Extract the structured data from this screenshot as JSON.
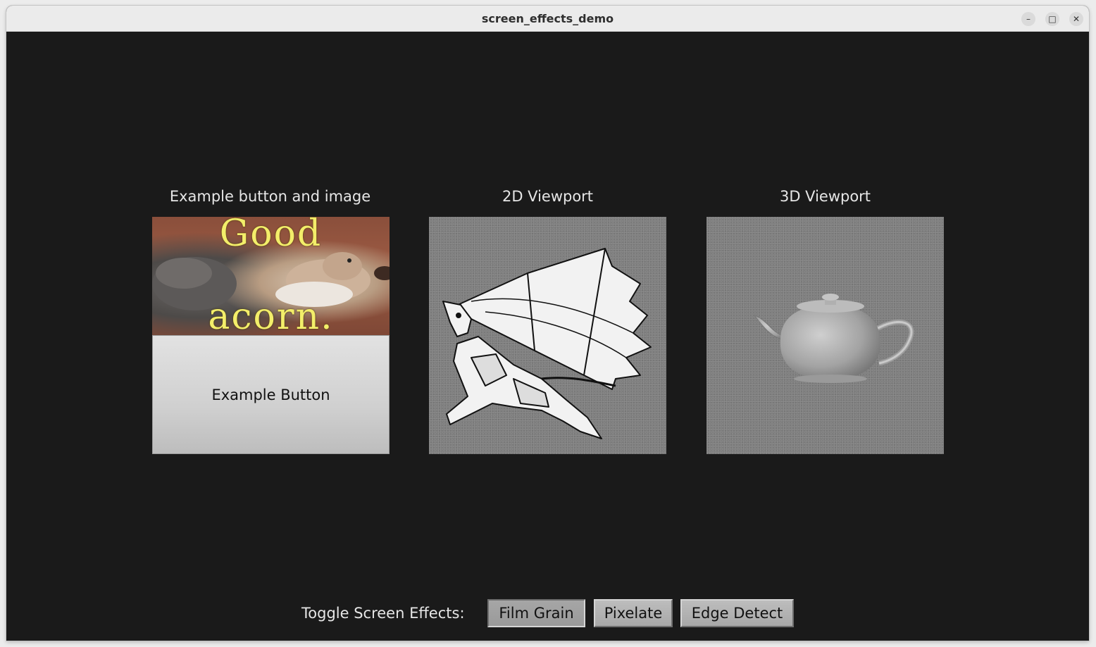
{
  "window": {
    "title": "screen_effects_demo",
    "controls": {
      "minimize_icon": "–",
      "maximize_icon": "□",
      "close_icon": "✕"
    }
  },
  "sections": {
    "image_button": {
      "label": "Example button and image",
      "image_text_top": "Good",
      "image_text_bottom": "acorn.",
      "button_label": "Example Button"
    },
    "viewport_2d": {
      "label": "2D Viewport"
    },
    "viewport_3d": {
      "label": "3D Viewport"
    }
  },
  "toolbar": {
    "label": "Toggle Screen Effects:",
    "buttons": [
      {
        "label": "Film Grain",
        "active": true
      },
      {
        "label": "Pixelate",
        "active": false
      },
      {
        "label": "Edge Detect",
        "active": false
      }
    ]
  },
  "colors": {
    "background": "#1a1a1a",
    "text": "#e6e6e6",
    "image_text": "#f3ee6a"
  }
}
